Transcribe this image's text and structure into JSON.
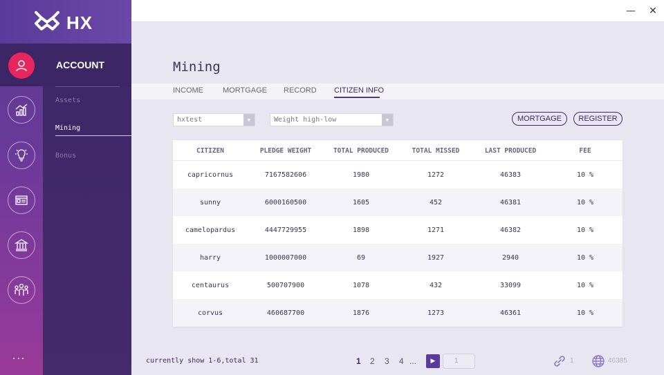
{
  "brand": {
    "name": "HX"
  },
  "window": {
    "minimize": "—",
    "close": "✕"
  },
  "rail": {
    "items": [
      {
        "icon": "user-icon",
        "active": true
      },
      {
        "icon": "chart-icon"
      },
      {
        "icon": "lightbulb-icon"
      },
      {
        "icon": "id-card-icon"
      },
      {
        "icon": "bank-icon"
      },
      {
        "icon": "group-icon"
      }
    ],
    "more": "..."
  },
  "sidebar": {
    "title": "ACCOUNT",
    "items": [
      {
        "label": "Assets"
      },
      {
        "label": "Mining",
        "active": true
      },
      {
        "label": "Bonus"
      }
    ]
  },
  "page": {
    "title": "Mining"
  },
  "tabs": [
    {
      "label": "INCOME"
    },
    {
      "label": "MORTGAGE"
    },
    {
      "label": "RECORD"
    },
    {
      "label": "CITIZEN INFO",
      "active": true
    }
  ],
  "filters": {
    "account": "hxtest",
    "sort": "Weight high-low"
  },
  "actions": {
    "mortgage": "MORTGAGE",
    "register": "REGISTER"
  },
  "table": {
    "headers": [
      "CITIZEN",
      "PLEDGE WEIGHT",
      "TOTAL PRODUCED",
      "TOTAL MISSED",
      "LAST PRODUCED",
      "FEE"
    ],
    "rows": [
      [
        "capricornus",
        "7167582606",
        "1980",
        "1272",
        "46383",
        "10 %"
      ],
      [
        "sunny",
        "6000160500",
        "1605",
        "452",
        "46381",
        "10 %"
      ],
      [
        "camelopardus",
        "4447729955",
        "1898",
        "1271",
        "46382",
        "10 %"
      ],
      [
        "harry",
        "1000007000",
        "69",
        "1927",
        "2940",
        "10 %"
      ],
      [
        "centaurus",
        "500707900",
        "1078",
        "432",
        "33099",
        "10 %"
      ],
      [
        "corvus",
        "460687700",
        "1876",
        "1273",
        "46361",
        "10 %"
      ]
    ]
  },
  "pagination": {
    "summary": "currently show 1-6,total 31",
    "pages": [
      "1",
      "2",
      "3",
      "4"
    ],
    "ellipsis": "...",
    "current": "1",
    "input_value": "1"
  },
  "status": {
    "connections": "1",
    "block_height": "46385"
  },
  "colors": {
    "accent": "#3e2868",
    "active_icon": "#e8265e",
    "sidebar": "#452a6c"
  }
}
